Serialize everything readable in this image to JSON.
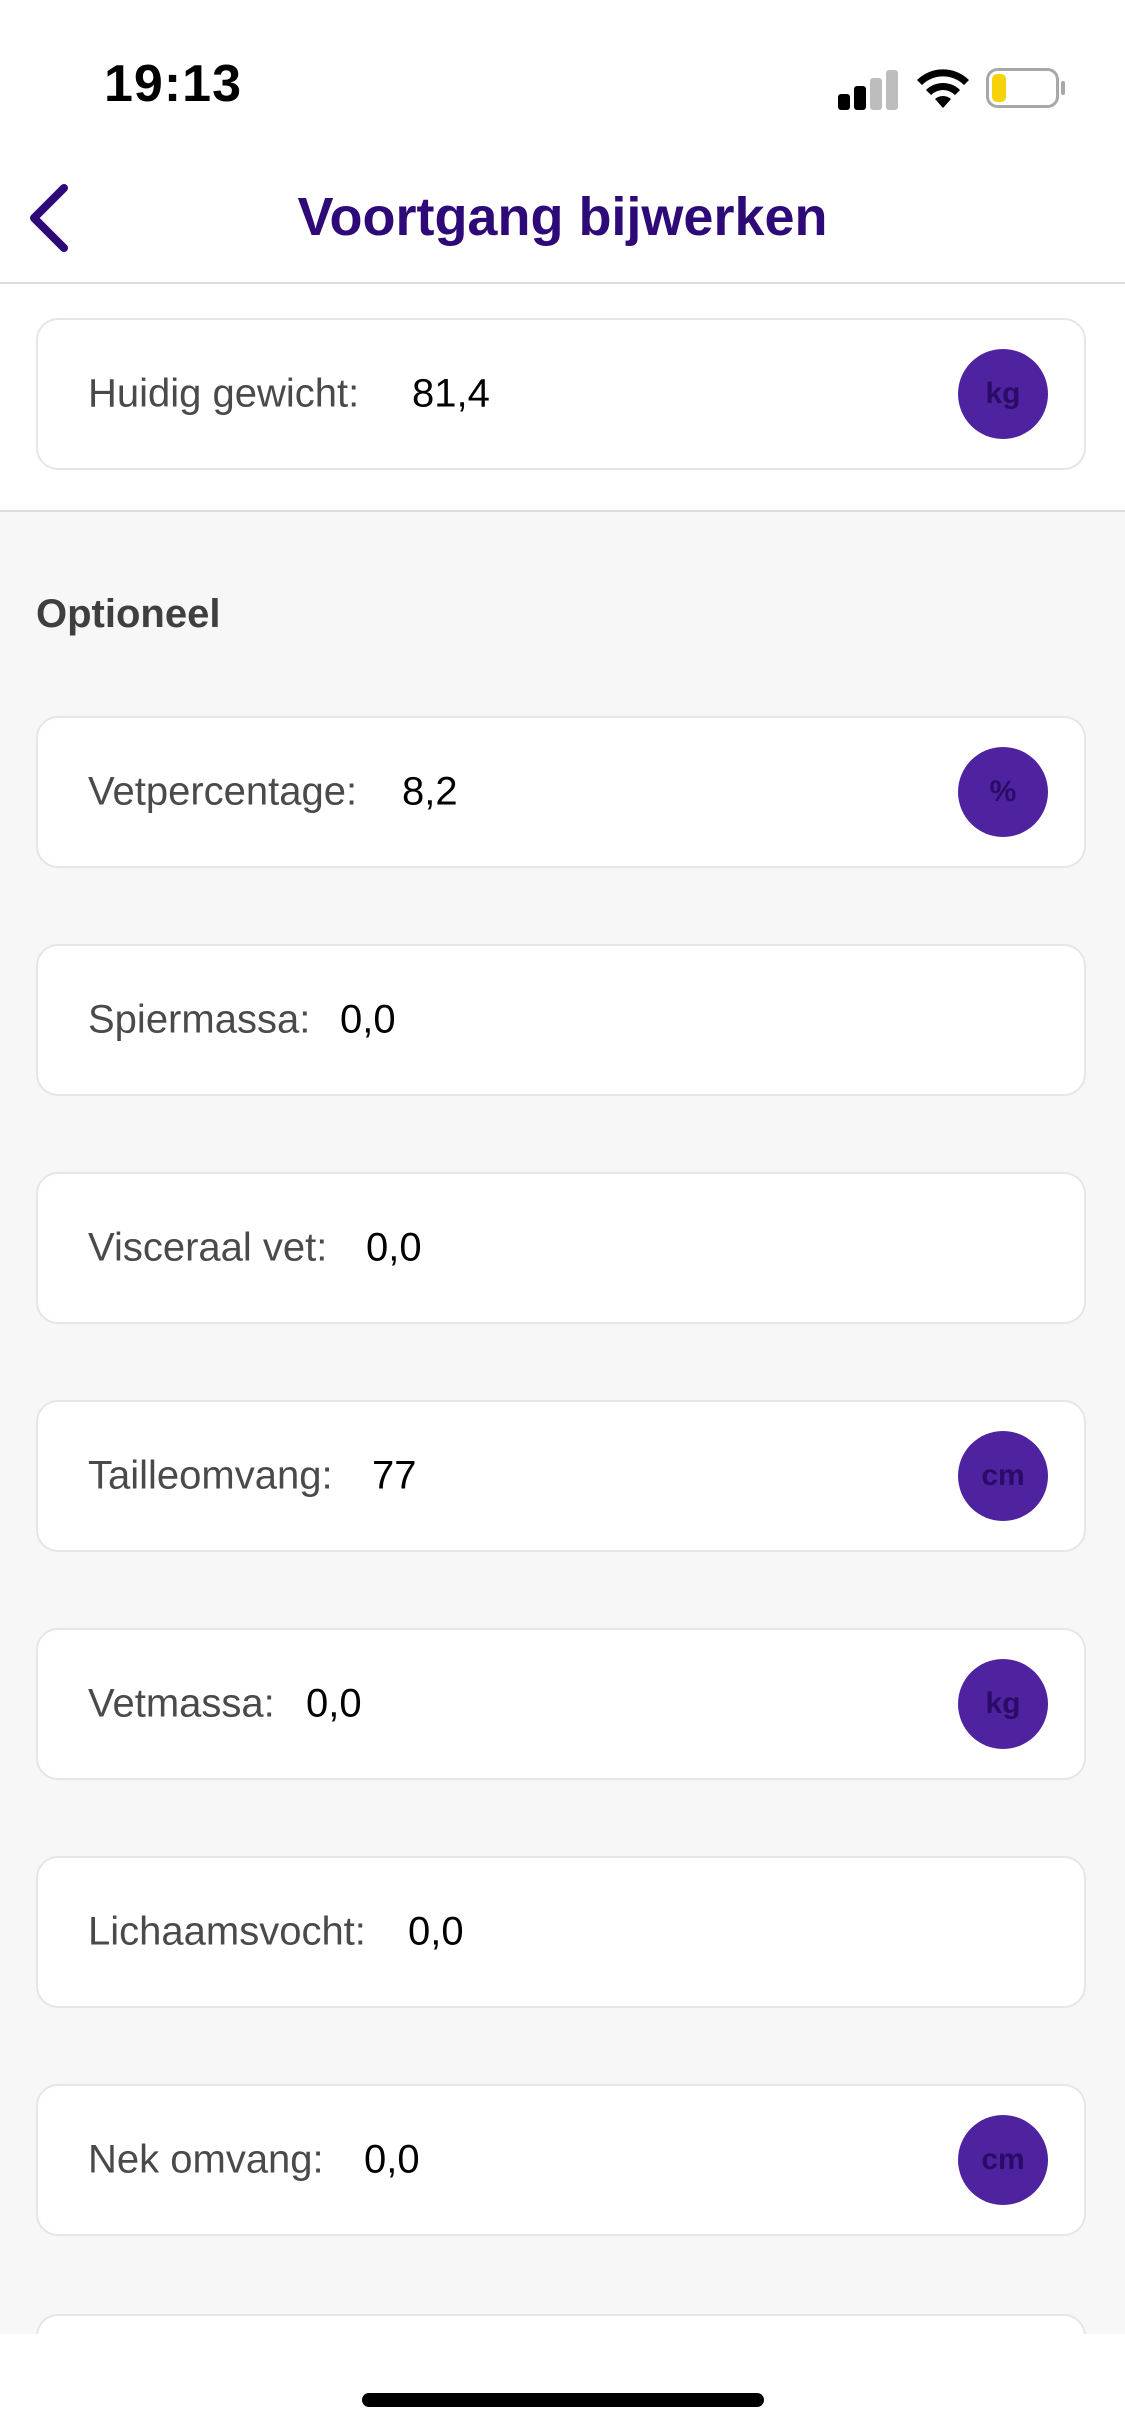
{
  "status_bar": {
    "time": "19:13",
    "signal_icon": "cellular-signal-icon",
    "wifi_icon": "wifi-icon",
    "battery_icon": "battery-icon",
    "battery_level": 0.2,
    "battery_color": "#f5d20a"
  },
  "nav": {
    "title": "Voortgang bijwerken",
    "back_icon": "chevron-left-icon"
  },
  "colors": {
    "accent": "#2e0a78",
    "badge": "#4f23a0",
    "badge_text": "#2a0b66"
  },
  "current_weight": {
    "label": "Huidig gewicht:",
    "value": "81,4",
    "unit": "kg"
  },
  "optional": {
    "heading": "Optioneel",
    "fields": [
      {
        "label": "Vetpercentage:",
        "value": "8,2",
        "unit": "%"
      },
      {
        "label": "Spiermassa:",
        "value": "0,0",
        "unit": ""
      },
      {
        "label": "Visceraal vet:",
        "value": "0,0",
        "unit": ""
      },
      {
        "label": "Tailleomvang:",
        "value": "77",
        "unit": "cm"
      },
      {
        "label": "Vetmassa:",
        "value": "0,0",
        "unit": "kg"
      },
      {
        "label": "Lichaamsvocht:",
        "value": "0,0",
        "unit": ""
      },
      {
        "label": "Nek omvang:",
        "value": "0,0",
        "unit": "cm"
      }
    ]
  }
}
